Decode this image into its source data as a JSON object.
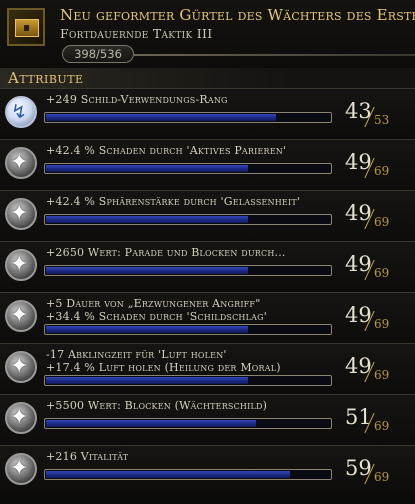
{
  "header": {
    "title": "Neu geformter Gürtel des Wächters des Erste",
    "subtitle": "Fortdauernde Taktik III",
    "xp": "398/536",
    "xp_fraction": 0.743
  },
  "section_title": "Attribute",
  "rows": [
    {
      "icon": "lightning-icon",
      "line1": "+249 Schild-Verwendungs-Rang",
      "line2": "",
      "current": "43",
      "max": "53",
      "fill": 0.81
    },
    {
      "icon": "star-icon",
      "line1": "+42.4 % Schaden durch 'Aktives Parieren'",
      "line2": "",
      "current": "49",
      "max": "69",
      "fill": 0.71
    },
    {
      "icon": "star-icon",
      "line1": "+42.4 % Sphärenstärke durch 'Gelassenheit'",
      "line2": "",
      "current": "49",
      "max": "69",
      "fill": 0.71
    },
    {
      "icon": "star-icon",
      "line1": "+2650 Wert: Parade und Blocken durch...",
      "line2": "",
      "current": "49",
      "max": "69",
      "fill": 0.71
    },
    {
      "icon": "star-icon",
      "line1": "+5 Dauer von „Erzwungener Angriff\"",
      "line2": "+34.4 % Schaden durch 'Schildschlag'",
      "current": "49",
      "max": "69",
      "fill": 0.71
    },
    {
      "icon": "star-icon",
      "line1": "-17 Abklingzeit für 'Luft holen'",
      "line2": "+17.4 % Luft holen (Heilung der Moral)",
      "current": "49",
      "max": "69",
      "fill": 0.71
    },
    {
      "icon": "star-icon",
      "line1": "+5500 Wert: Blocken (Wächterschild)",
      "line2": "",
      "current": "51",
      "max": "69",
      "fill": 0.74
    },
    {
      "icon": "star-icon",
      "line1": "+216 Vitalität",
      "line2": "",
      "current": "59",
      "max": "69",
      "fill": 0.86
    }
  ]
}
